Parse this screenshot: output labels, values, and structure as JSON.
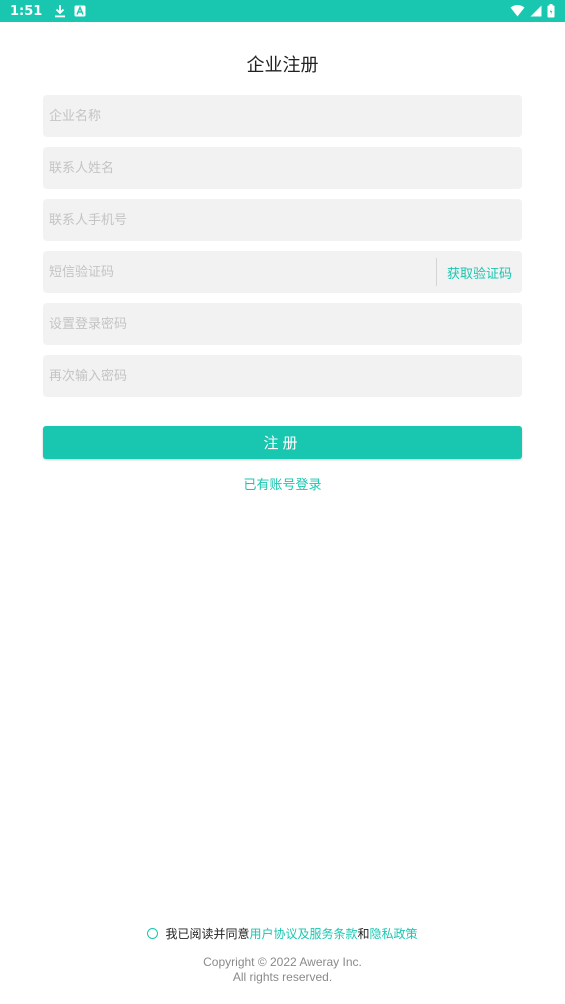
{
  "status_bar": {
    "time": "1:51",
    "icons": [
      "download-icon",
      "font-icon",
      "wifi-icon",
      "signal-icon",
      "battery-icon"
    ]
  },
  "page": {
    "title": "企业注册"
  },
  "form": {
    "company_name_placeholder": "企业名称",
    "contact_name_placeholder": "联系人姓名",
    "contact_phone_placeholder": "联系人手机号",
    "sms_code_placeholder": "短信验证码",
    "get_code_label": "获取验证码",
    "password_placeholder": "设置登录密码",
    "confirm_password_placeholder": "再次输入密码",
    "submit_label": "注册"
  },
  "login_link": "已有账号登录",
  "agreement": {
    "prefix": "我已阅读并同意",
    "terms": "用户协议及服务条款",
    "and": "和",
    "privacy": "隐私政策"
  },
  "copyright": {
    "line1": "Copyright © 2022 Aweray Inc.",
    "line2": "All rights reserved."
  },
  "colors": {
    "accent": "#19c6b0",
    "field_bg": "#f2f2f2",
    "placeholder": "#c4c4c4"
  }
}
